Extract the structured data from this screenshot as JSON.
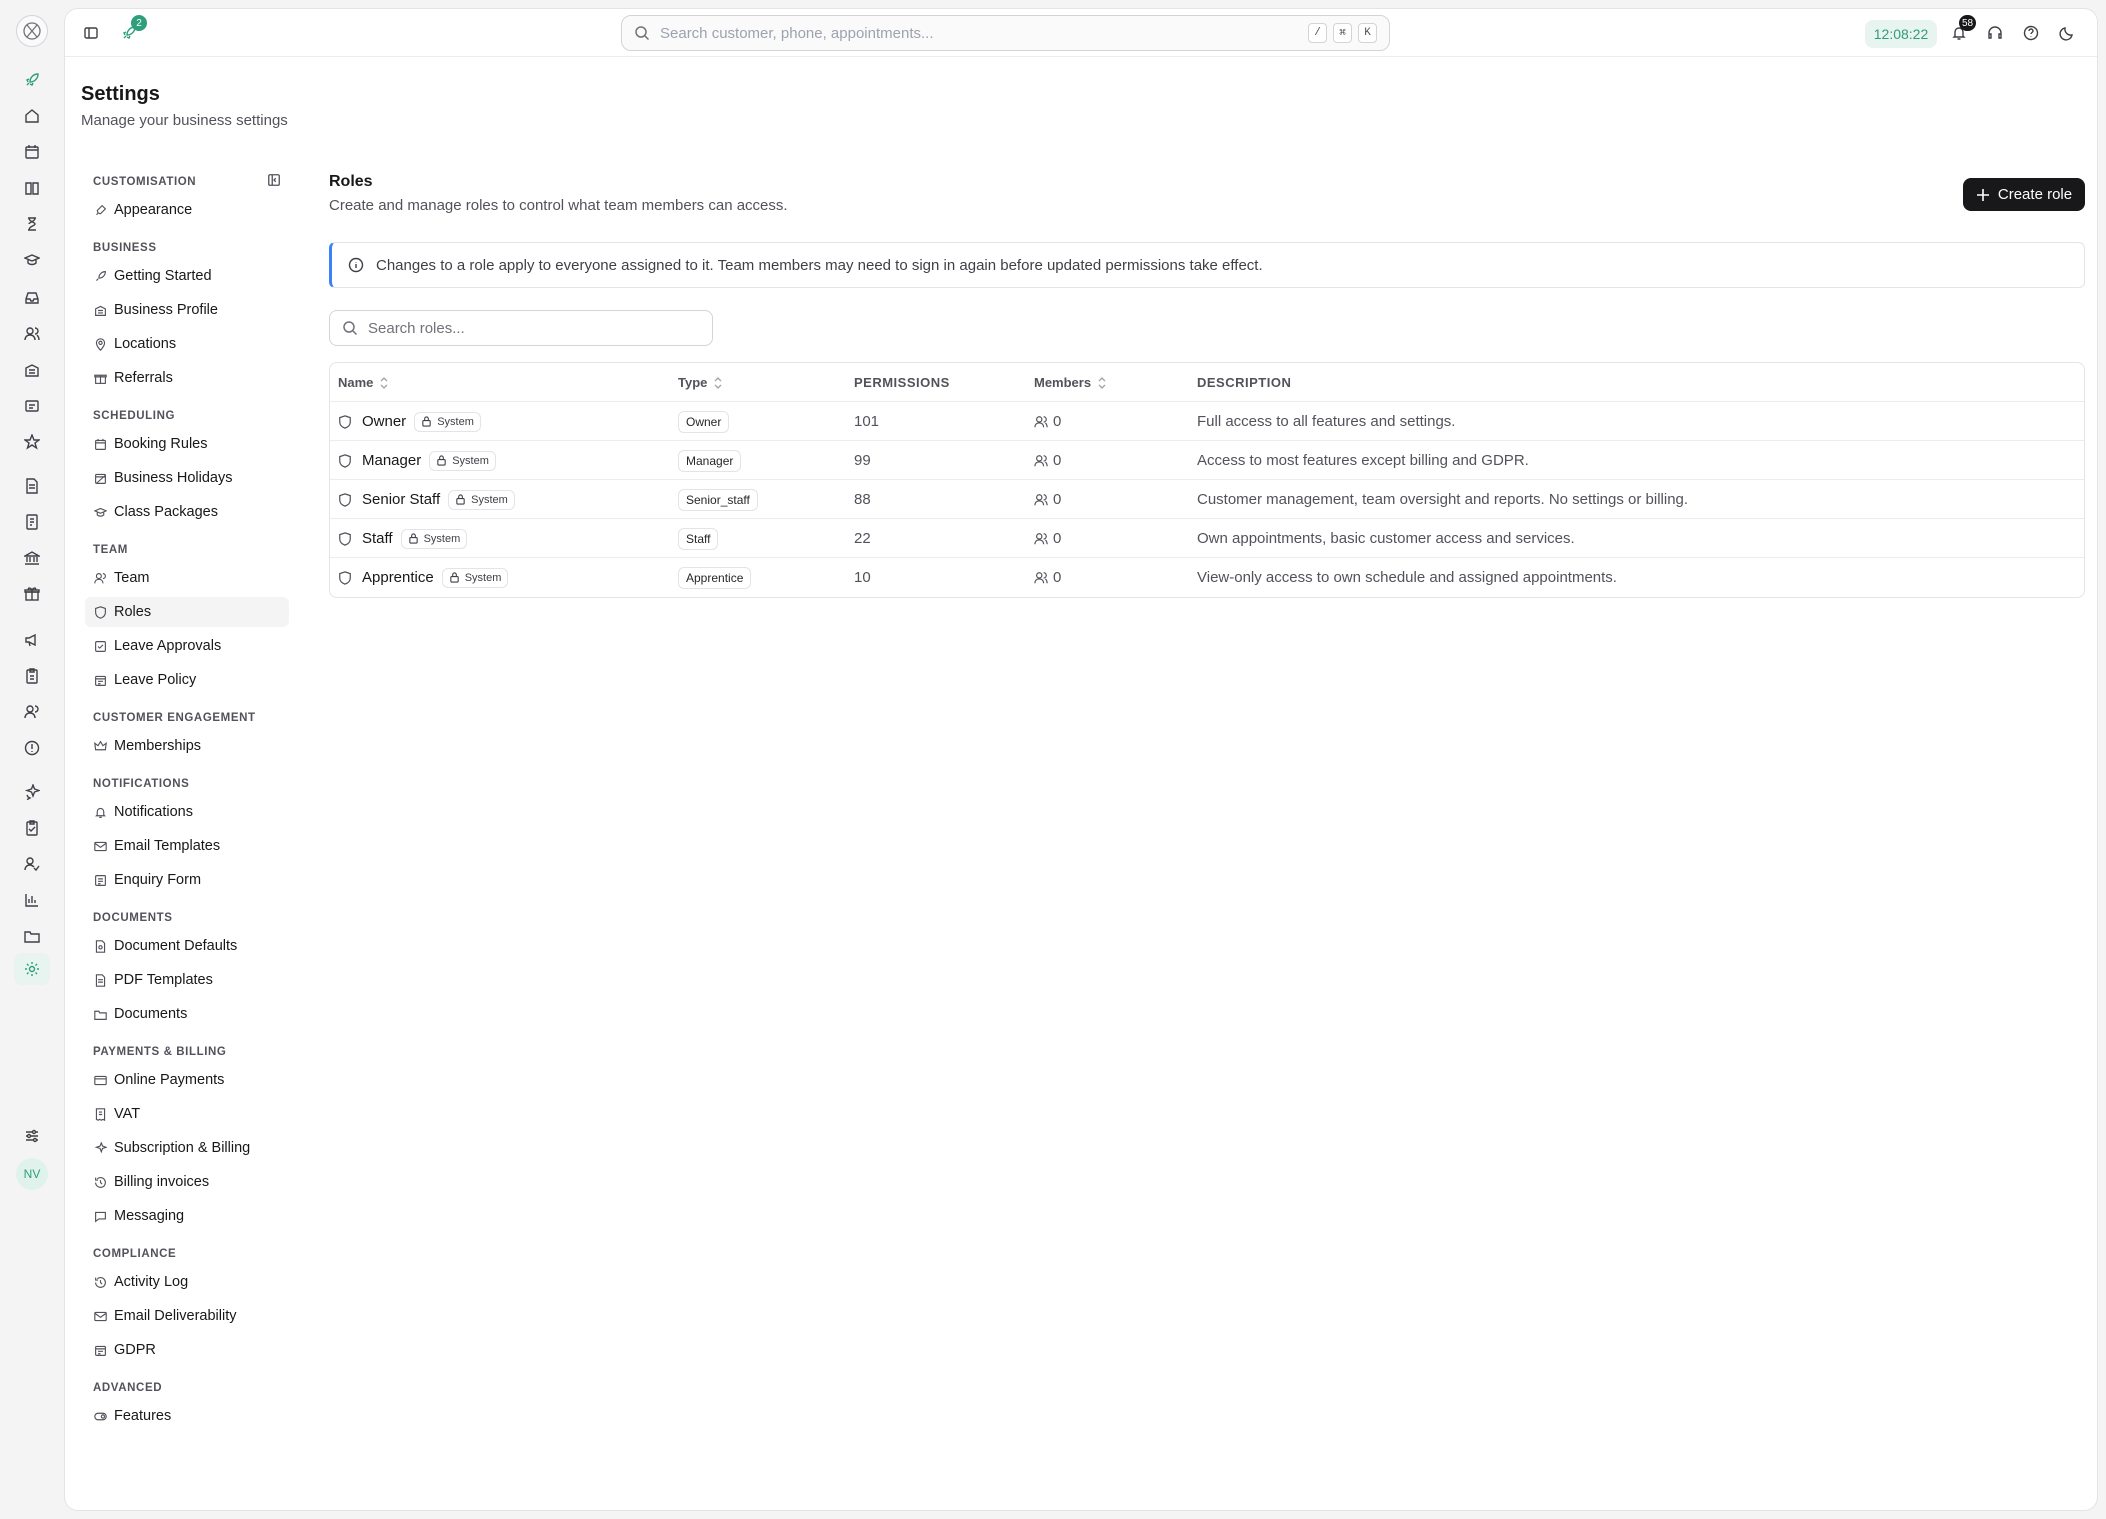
{
  "app": {
    "notif_badge": "58",
    "rocket_badge": "2",
    "clock": "12:08:22",
    "avatar": "NV"
  },
  "search": {
    "placeholder": "Search customer, phone, appointments...",
    "keys": [
      "/",
      "⌘",
      "K"
    ]
  },
  "page": {
    "title": "Settings",
    "subtitle": "Manage your business settings"
  },
  "settings_nav": [
    {
      "heading": "CUSTOMISATION",
      "items": [
        {
          "label": "Appearance",
          "icon": "brush-icon"
        }
      ]
    },
    {
      "heading": "BUSINESS",
      "items": [
        {
          "label": "Getting Started",
          "icon": "rocket-icon"
        },
        {
          "label": "Business Profile",
          "icon": "building-icon"
        },
        {
          "label": "Locations",
          "icon": "pin-icon"
        },
        {
          "label": "Referrals",
          "icon": "gift-icon"
        }
      ]
    },
    {
      "heading": "SCHEDULING",
      "items": [
        {
          "label": "Booking Rules",
          "icon": "calendar-icon"
        },
        {
          "label": "Business Holidays",
          "icon": "calendar-off-icon"
        },
        {
          "label": "Class Packages",
          "icon": "graduation-icon"
        }
      ]
    },
    {
      "heading": "TEAM",
      "items": [
        {
          "label": "Team",
          "icon": "users-icon"
        },
        {
          "label": "Roles",
          "icon": "shield-icon",
          "active": true
        },
        {
          "label": "Leave Approvals",
          "icon": "check-square-icon"
        },
        {
          "label": "Leave Policy",
          "icon": "calendar-policy-icon"
        }
      ]
    },
    {
      "heading": "CUSTOMER ENGAGEMENT",
      "items": [
        {
          "label": "Memberships",
          "icon": "crown-icon"
        }
      ]
    },
    {
      "heading": "NOTIFICATIONS",
      "items": [
        {
          "label": "Notifications",
          "icon": "bell-icon"
        },
        {
          "label": "Email Templates",
          "icon": "mail-icon"
        },
        {
          "label": "Enquiry Form",
          "icon": "form-icon"
        }
      ]
    },
    {
      "heading": "DOCUMENTS",
      "items": [
        {
          "label": "Document Defaults",
          "icon": "file-gear-icon"
        },
        {
          "label": "PDF Templates",
          "icon": "file-icon"
        },
        {
          "label": "Documents",
          "icon": "folder-icon"
        }
      ]
    },
    {
      "heading": "PAYMENTS & BILLING",
      "items": [
        {
          "label": "Online Payments",
          "icon": "card-icon"
        },
        {
          "label": "VAT",
          "icon": "receipt-icon"
        },
        {
          "label": "Subscription & Billing",
          "icon": "sparkle-icon"
        },
        {
          "label": "Billing invoices",
          "icon": "history-icon"
        },
        {
          "label": "Messaging",
          "icon": "message-icon"
        }
      ]
    },
    {
      "heading": "COMPLIANCE",
      "items": [
        {
          "label": "Activity Log",
          "icon": "history-icon"
        },
        {
          "label": "Email Deliverability",
          "icon": "mail-check-icon"
        },
        {
          "label": "GDPR",
          "icon": "calendar-policy-icon"
        }
      ]
    },
    {
      "heading": "ADVANCED",
      "items": [
        {
          "label": "Features",
          "icon": "toggle-icon"
        }
      ]
    }
  ],
  "roles": {
    "title": "Roles",
    "subtitle": "Create and manage roles to control what team members can access.",
    "create_label": "Create role",
    "alert": "Changes to a role apply to everyone assigned to it. Team members may need to sign in again before updated permissions take effect.",
    "search_placeholder": "Search roles...",
    "columns": {
      "name": "Name",
      "type": "Type",
      "permissions": "PERMISSIONS",
      "members": "Members",
      "description": "DESCRIPTION"
    },
    "rows": [
      {
        "name": "Owner",
        "badge": "System",
        "type": "Owner",
        "permissions": "101",
        "members": "0",
        "description": "Full access to all features and settings."
      },
      {
        "name": "Manager",
        "badge": "System",
        "type": "Manager",
        "permissions": "99",
        "members": "0",
        "description": "Access to most features except billing and GDPR."
      },
      {
        "name": "Senior Staff",
        "badge": "System",
        "type": "Senior_staff",
        "permissions": "88",
        "members": "0",
        "description": "Customer management, team oversight and reports. No settings or billing."
      },
      {
        "name": "Staff",
        "badge": "System",
        "type": "Staff",
        "permissions": "22",
        "members": "0",
        "description": "Own appointments, basic customer access and services."
      },
      {
        "name": "Apprentice",
        "badge": "System",
        "type": "Apprentice",
        "permissions": "10",
        "members": "0",
        "description": "View-only access to own schedule and assigned appointments."
      }
    ]
  }
}
